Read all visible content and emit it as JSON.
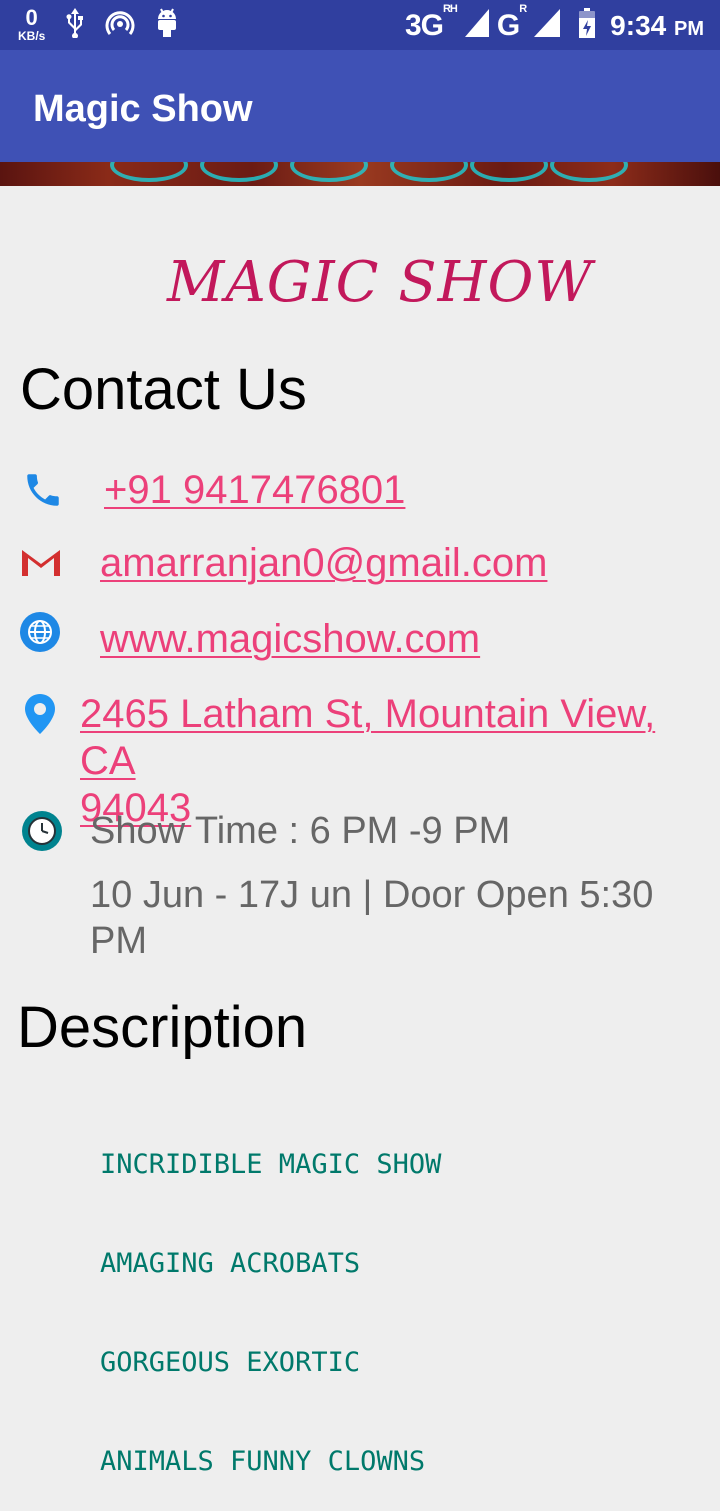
{
  "status_bar": {
    "speed_value": "0",
    "speed_unit": "KB/s",
    "network1": "3G",
    "network1_sup": "RH",
    "network2": "G",
    "network2_sup": "R",
    "time": "9:34",
    "ampm": "PM",
    "icons": [
      "usb-icon",
      "hotspot-icon",
      "android-icon",
      "signal-icon",
      "battery-icon"
    ]
  },
  "appbar": {
    "title": "Magic Show"
  },
  "content": {
    "brand_title": "MAGIC SHOW",
    "contact_heading": "Contact Us",
    "phone": "+91 9417476801",
    "email": "amarranjan0@gmail.com",
    "website": "www.magicshow.com",
    "address_line1": "2465 Latham St, Mountain View, CA",
    "address_line2": "94043",
    "show_time": "Show Time : 6 PM -9 PM",
    "dates_line1": "10 Jun - 17J un | Door Open 5:30",
    "dates_line2": "PM",
    "description_heading": "Description",
    "description_lines": [
      "INCRIDIBLE MAGIC SHOW",
      "AMAGING ACROBATS",
      "GORGEOUS EXORTIC",
      "ANIMALS FUNNY CLOWNS"
    ]
  },
  "colors": {
    "status_bar": "#303f9f",
    "app_bar": "#3f51b5",
    "link": "#ec407a",
    "brand": "#c2185b",
    "description": "#00796b"
  }
}
